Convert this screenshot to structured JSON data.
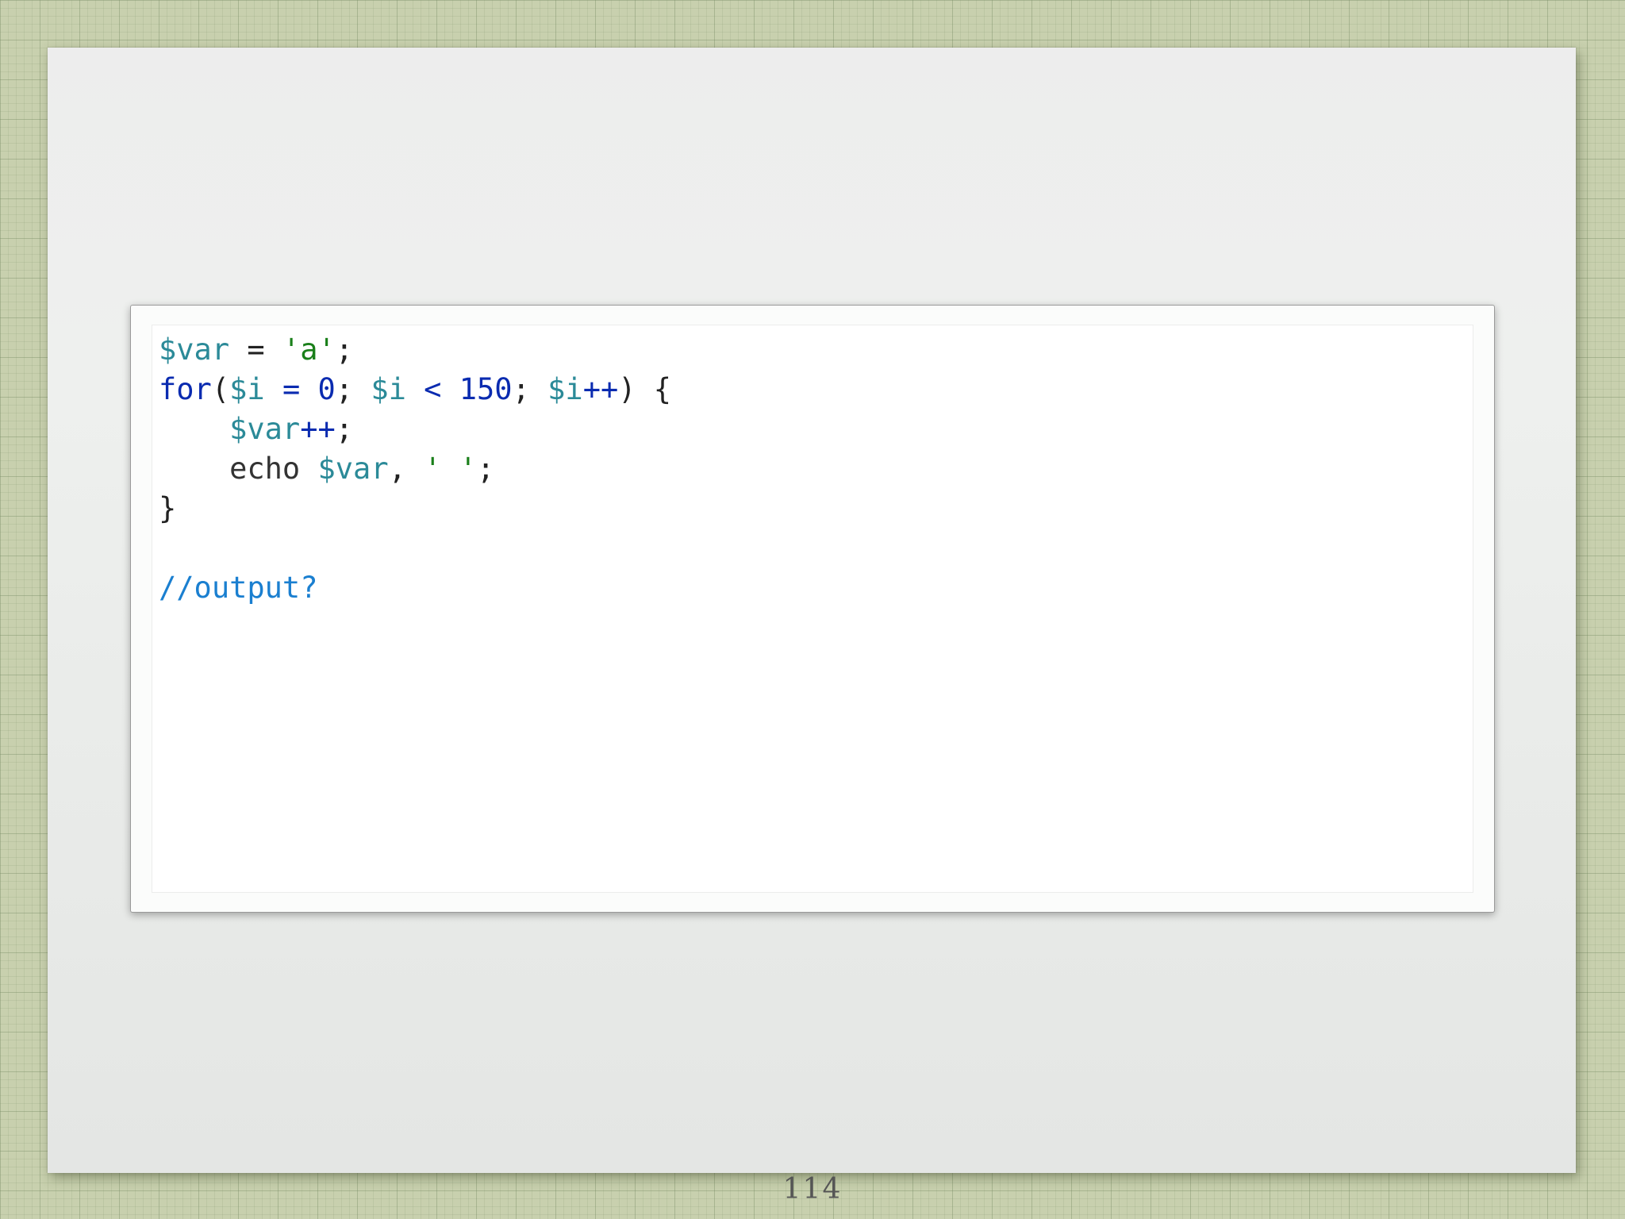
{
  "code": {
    "lines": [
      [
        {
          "t": "$var",
          "c": "var"
        },
        {
          "t": " = ",
          "c": "plain"
        },
        {
          "t": "'a'",
          "c": "str"
        },
        {
          "t": ";",
          "c": "plain"
        }
      ],
      [
        {
          "t": "for",
          "c": "kw"
        },
        {
          "t": "(",
          "c": "plain"
        },
        {
          "t": "$i",
          "c": "var"
        },
        {
          "t": " = ",
          "c": "op"
        },
        {
          "t": "0",
          "c": "num"
        },
        {
          "t": "; ",
          "c": "plain"
        },
        {
          "t": "$i",
          "c": "var"
        },
        {
          "t": " < ",
          "c": "op"
        },
        {
          "t": "150",
          "c": "num"
        },
        {
          "t": "; ",
          "c": "plain"
        },
        {
          "t": "$i",
          "c": "var"
        },
        {
          "t": "++",
          "c": "op"
        },
        {
          "t": ") {",
          "c": "plain"
        }
      ],
      [
        {
          "t": "    ",
          "c": "plain"
        },
        {
          "t": "$var",
          "c": "var"
        },
        {
          "t": "++",
          "c": "op"
        },
        {
          "t": ";",
          "c": "plain"
        }
      ],
      [
        {
          "t": "    ",
          "c": "plain"
        },
        {
          "t": "echo",
          "c": "fn"
        },
        {
          "t": " ",
          "c": "plain"
        },
        {
          "t": "$var",
          "c": "var"
        },
        {
          "t": ", ",
          "c": "plain"
        },
        {
          "t": "' '",
          "c": "str"
        },
        {
          "t": ";",
          "c": "plain"
        }
      ],
      [
        {
          "t": "}",
          "c": "plain"
        }
      ],
      [],
      [
        {
          "t": "//output?",
          "c": "comment"
        }
      ]
    ]
  },
  "slide": {
    "page_number": "114"
  }
}
